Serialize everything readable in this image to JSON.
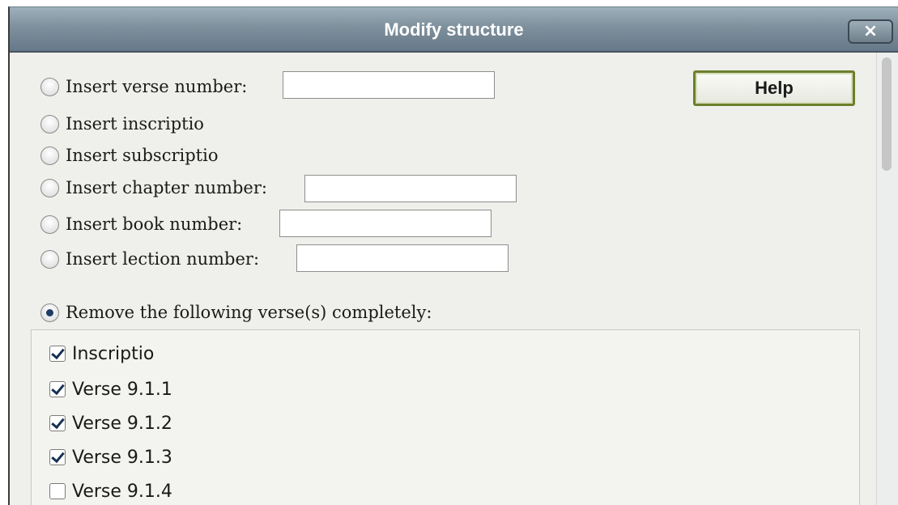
{
  "dialog": {
    "title": "Modify structure",
    "close_label": "×",
    "help_label": "Help"
  },
  "options": [
    {
      "label": "Insert verse number:",
      "checked": false,
      "input_value": ""
    },
    {
      "label": "Insert inscriptio",
      "checked": false
    },
    {
      "label": "Insert subscriptio",
      "checked": false
    },
    {
      "label": "Insert chapter number:",
      "checked": false,
      "input_value": ""
    },
    {
      "label": "Insert book number:",
      "checked": false,
      "input_value": ""
    },
    {
      "label": "Insert lection number:",
      "checked": false,
      "input_value": ""
    },
    {
      "label": "Remove the following verse(s) completely:",
      "checked": true
    }
  ],
  "verses": [
    {
      "label": "Inscriptio",
      "checked": true
    },
    {
      "label": "Verse 9.1.1",
      "checked": true
    },
    {
      "label": "Verse 9.1.2",
      "checked": true
    },
    {
      "label": "Verse 9.1.3",
      "checked": true
    },
    {
      "label": "Verse 9.1.4",
      "checked": false
    }
  ],
  "colors": {
    "titlebar": "#7e909c",
    "dialog_bg": "#efefeb",
    "help_border": "#6b7f2c",
    "check_mark": "#163056"
  }
}
